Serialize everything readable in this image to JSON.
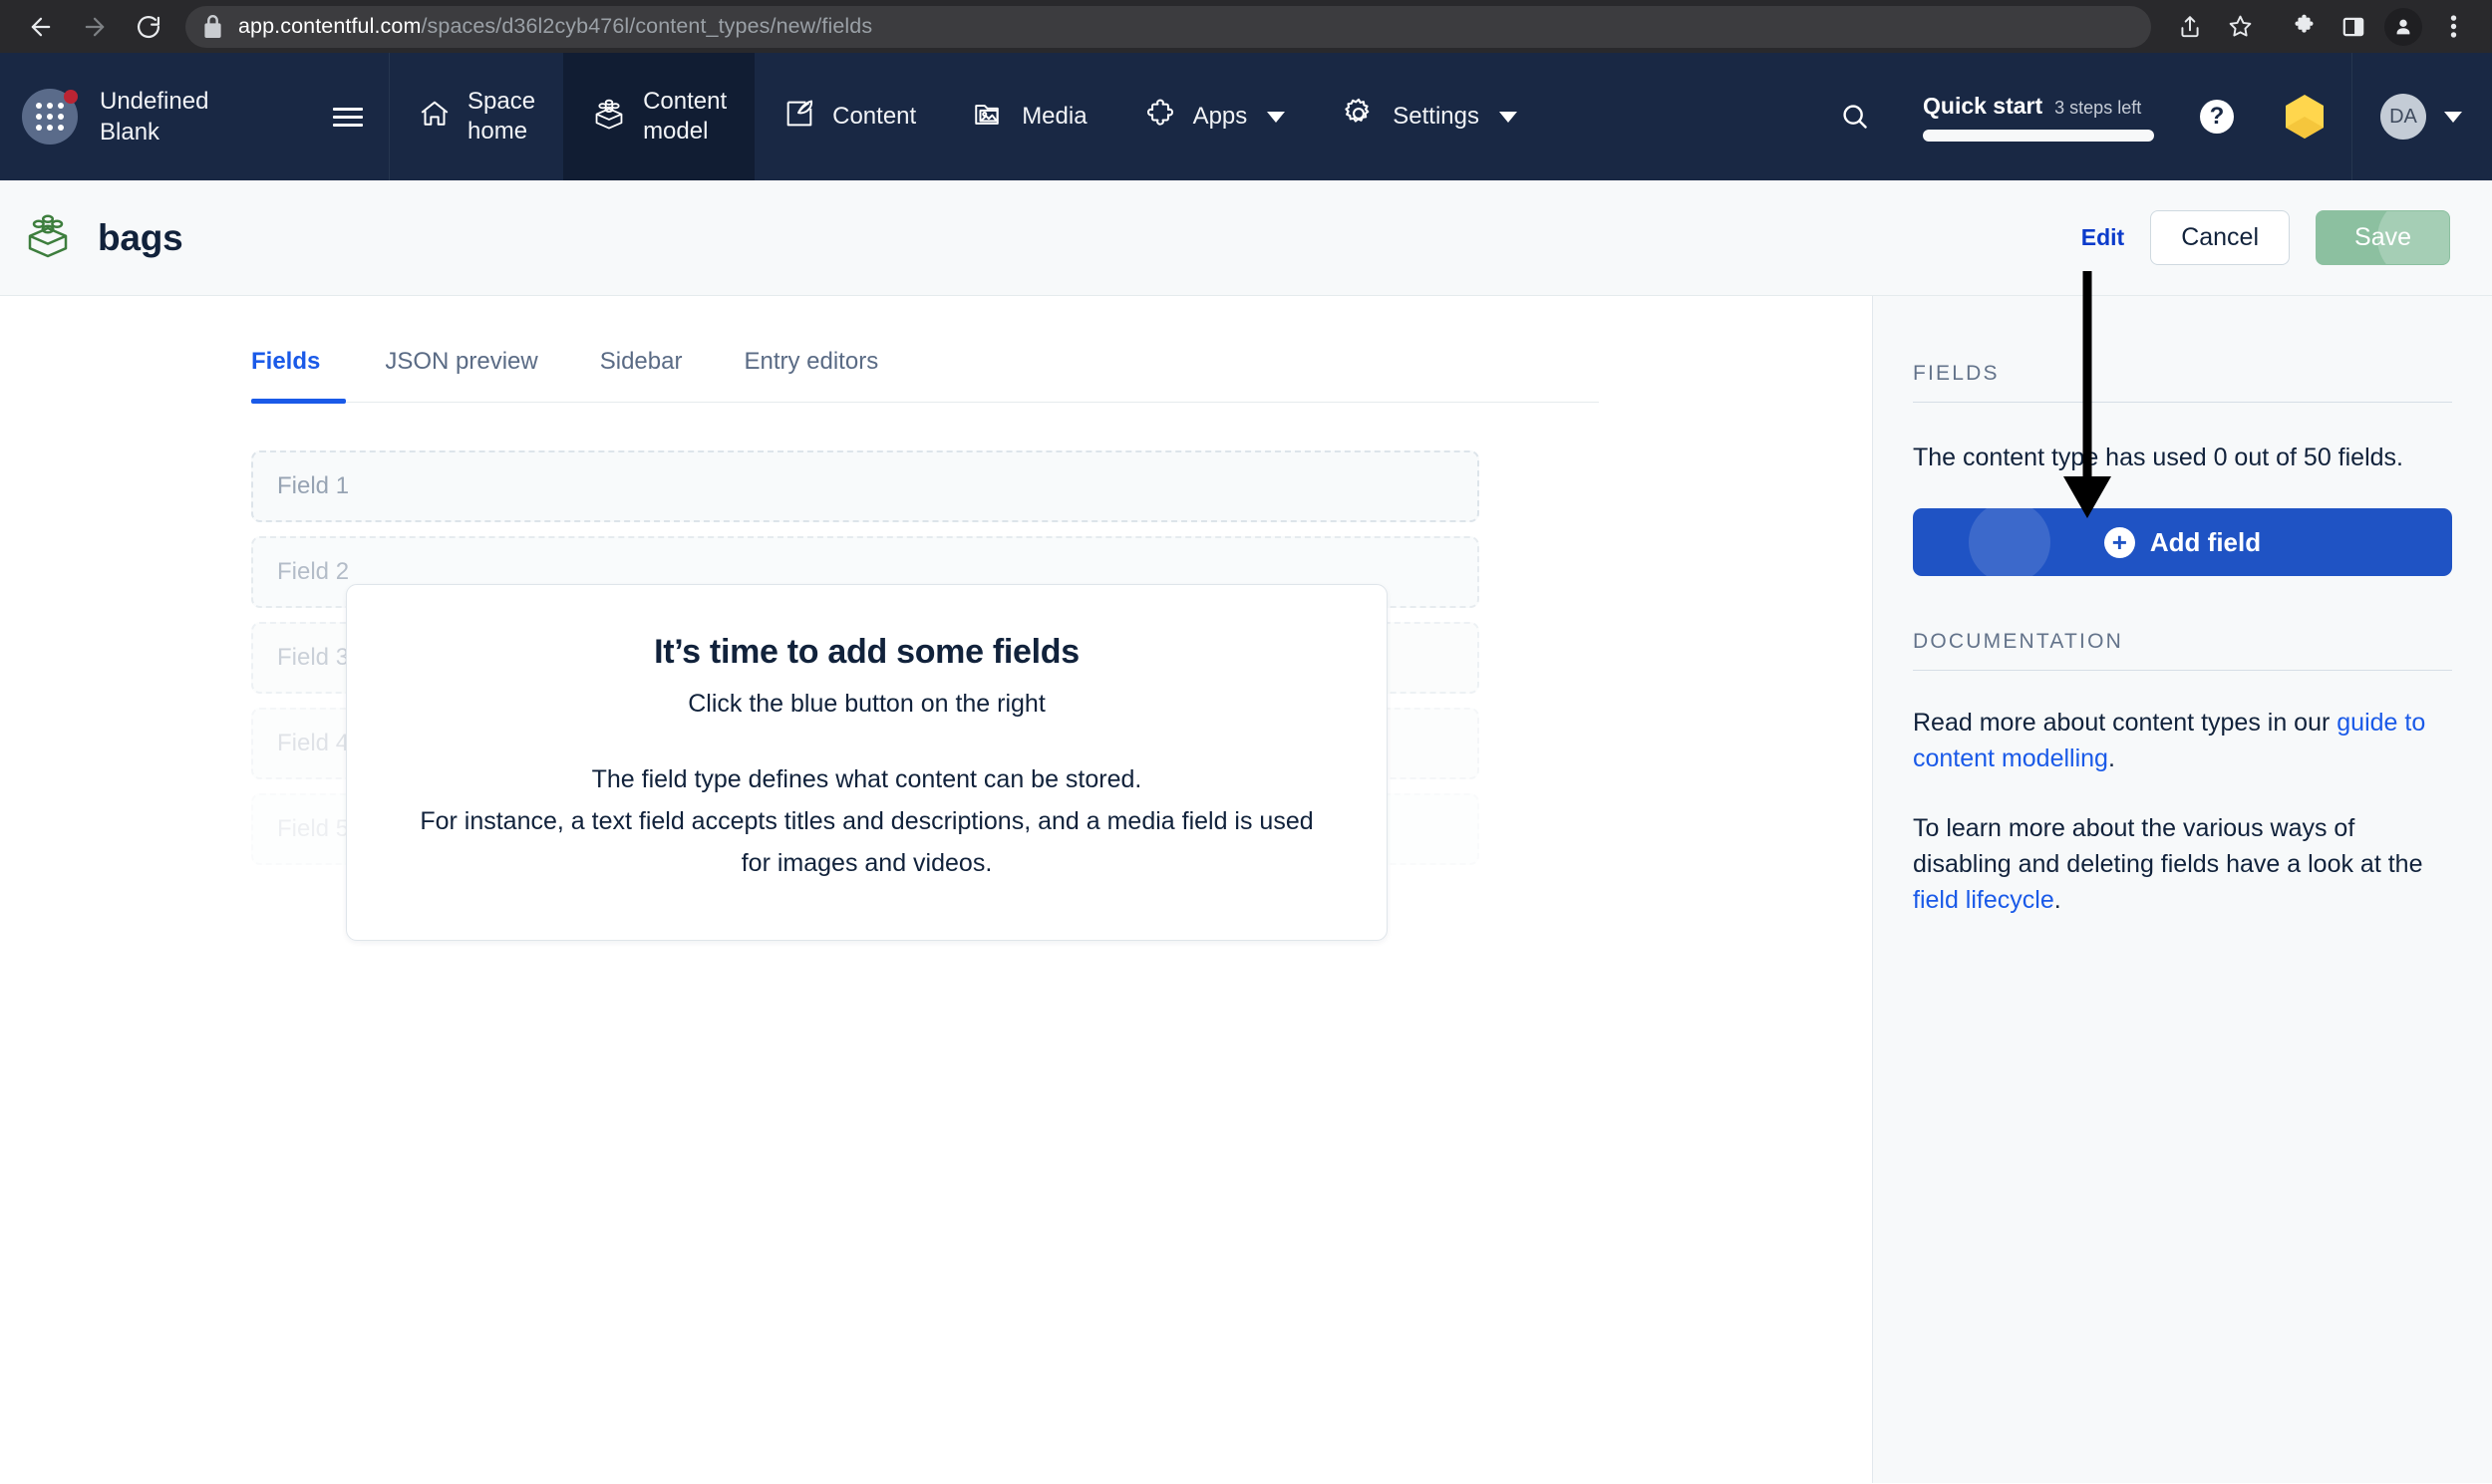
{
  "browser": {
    "back_icon": "back-arrow-icon",
    "forward_icon": "forward-arrow-icon",
    "reload_icon": "reload-icon",
    "lock_icon": "lock-icon",
    "url_host": "app.contentful.com",
    "url_path": "/spaces/d36l2cyb476l/content_types/new/fields",
    "toolbar_icons": [
      "share-icon",
      "bookmark-star-icon",
      "extensions-puzzle-icon",
      "side-panel-icon",
      "profile-icon",
      "overflow-menu-icon"
    ]
  },
  "topnav": {
    "app_switcher_icon": "app-grid-icon",
    "notification_badge": true,
    "space_name_line1": "Undefined",
    "space_name_line2": "Blank",
    "hamburger_icon": "hamburger-icon",
    "items": [
      {
        "label_line1": "Space",
        "label_line2": "home",
        "icon": "home-icon",
        "active": false,
        "has_caret": false
      },
      {
        "label_line1": "Content",
        "label_line2": "model",
        "icon": "content-model-icon",
        "active": true,
        "has_caret": false
      },
      {
        "label_line1": "Content",
        "label_line2": "",
        "icon": "content-pen-icon",
        "active": false,
        "has_caret": false
      },
      {
        "label_line1": "Media",
        "label_line2": "",
        "icon": "media-image-icon",
        "active": false,
        "has_caret": false
      },
      {
        "label_line1": "Apps",
        "label_line2": "",
        "icon": "apps-puzzle-icon",
        "active": false,
        "has_caret": true
      },
      {
        "label_line1": "Settings",
        "label_line2": "",
        "icon": "settings-gear-icon",
        "active": false,
        "has_caret": true
      }
    ],
    "search_icon": "search-icon",
    "quick_start": {
      "title": "Quick start",
      "steps_left": "3 steps left",
      "progress_percent": 100
    },
    "help_icon_label": "?",
    "brand_hex_icon": "contentful-hexagon-icon",
    "user_initials": "DA",
    "user_caret_icon": "chevron-down-icon"
  },
  "page_header": {
    "content_type_icon": "content-model-brick-icon",
    "title": "bags",
    "edit_label": "Edit",
    "cancel_label": "Cancel",
    "save_label": "Save"
  },
  "tabs": [
    {
      "label": "Fields",
      "active": true
    },
    {
      "label": "JSON preview",
      "active": false
    },
    {
      "label": "Sidebar",
      "active": false
    },
    {
      "label": "Entry editors",
      "active": false
    }
  ],
  "ghost_fields": [
    "Field 1",
    "Field 2",
    "Field 3",
    "Field 4",
    "Field 5"
  ],
  "onboarding_card": {
    "title": "It’s time to add some fields",
    "subtitle": "Click the blue button on the right",
    "body_line1": "The field type defines what content can be stored.",
    "body_line2": "For instance, a text field accepts titles and descriptions, and a media field is used for images and videos."
  },
  "sidebar": {
    "fields_heading": "FIELDS",
    "usage_text": "The content type has used 0 out of 50 fields.",
    "add_field_label": "Add field",
    "add_field_icon": "plus-circle-icon",
    "documentation_heading": "DOCUMENTATION",
    "doc_para1_prefix": "Read more about content types in our ",
    "doc_para1_link": "guide to content modelling",
    "doc_para1_suffix": ".",
    "doc_para2_prefix": "To learn more about the various ways of disabling and deleting fields have a look at the ",
    "doc_para2_link": "field lifecycle",
    "doc_para2_suffix": "."
  },
  "annotation": {
    "arrow_icon": "down-arrow-annotation",
    "color": "#000000"
  },
  "colors": {
    "nav_bg": "#192844",
    "nav_active_bg": "#111d33",
    "accent_blue": "#1f53c4",
    "link_blue": "#1a5ae8",
    "save_green": "#8cc0a0",
    "sidebar_bg": "#f7f9fa",
    "badge_red": "#bb2433",
    "brand_yellow": "#ffd64d"
  }
}
